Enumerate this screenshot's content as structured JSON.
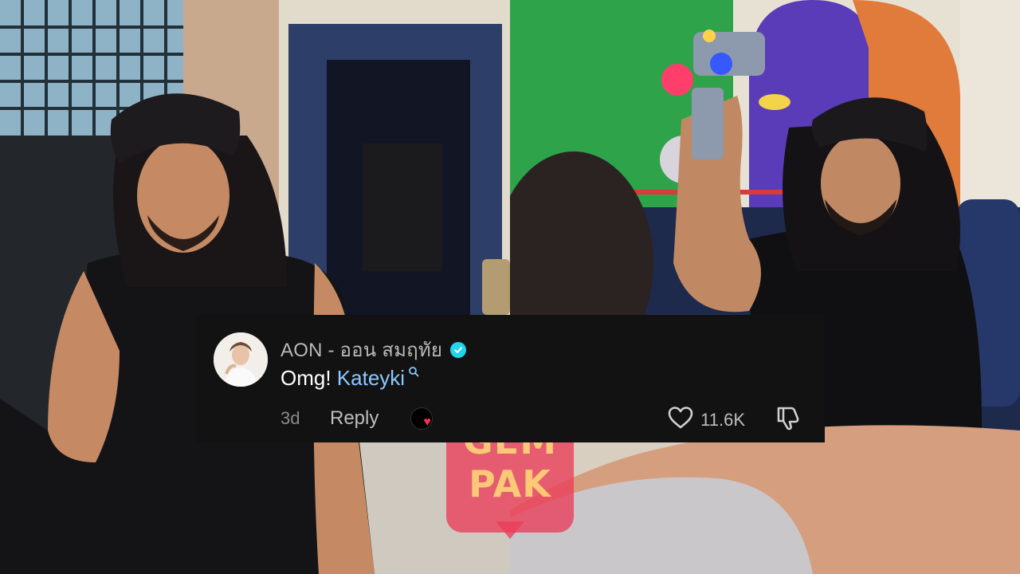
{
  "comment": {
    "username": "AON - ออน สมฤทัย",
    "verified": true,
    "text_prefix": "Omg! ",
    "mention": "Kateyki",
    "time": "3d",
    "reply_label": "Reply",
    "creator_liked": true,
    "likes": "11.6K",
    "icons": {
      "verified": "verified-check-icon",
      "search": "search-icon",
      "like": "heart-outline-icon",
      "dislike": "thumbs-down-icon",
      "creator_heart": "heart-icon"
    }
  },
  "watermark": {
    "line1": "GEM",
    "line2": "PAK"
  },
  "colors": {
    "card_bg": "#121212",
    "mention": "#8cc8ff",
    "verified": "#20d5ec",
    "heart": "#ff2d55",
    "watermark": "#eb3c5a"
  }
}
